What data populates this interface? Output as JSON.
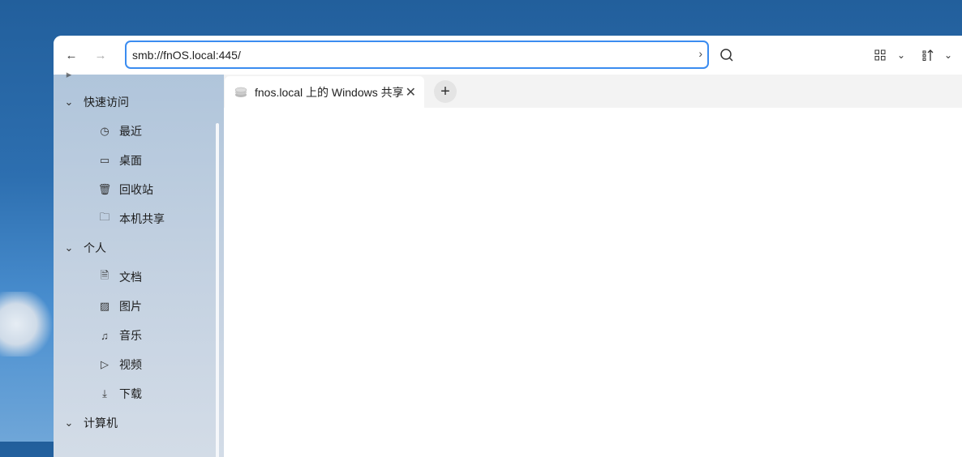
{
  "toolbar": {
    "address": "smb://fnOS.local:445/"
  },
  "tabs": [
    {
      "label": "fnos.local 上的 Windows 共享"
    }
  ],
  "sidebar": {
    "groups": [
      {
        "label": "快速访问",
        "items": [
          {
            "label": "最近",
            "icon": "clock-icon"
          },
          {
            "label": "桌面",
            "icon": "monitor-icon"
          },
          {
            "label": "回收站",
            "icon": "trash-icon"
          },
          {
            "label": "本机共享",
            "icon": "folder-icon"
          }
        ]
      },
      {
        "label": "个人",
        "items": [
          {
            "label": "文档",
            "icon": "document-icon"
          },
          {
            "label": "图片",
            "icon": "image-icon"
          },
          {
            "label": "音乐",
            "icon": "music-icon"
          },
          {
            "label": "视频",
            "icon": "video-icon"
          },
          {
            "label": "下载",
            "icon": "download-icon"
          }
        ]
      },
      {
        "label": "计算机",
        "items": []
      }
    ]
  }
}
